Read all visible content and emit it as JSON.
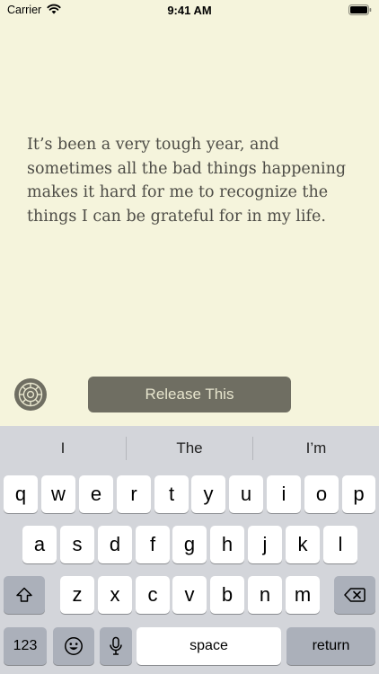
{
  "status_bar": {
    "carrier": "Carrier",
    "time": "9:41 AM"
  },
  "entry": {
    "text": "It’s been a very tough year, and sometimes all the bad things happening makes it hard for me to recognize the things I can be grateful for in my life."
  },
  "controls": {
    "release_label": "Release This"
  },
  "keyboard": {
    "suggestions": [
      "I",
      "The",
      "I’m"
    ],
    "row1": [
      "q",
      "w",
      "e",
      "r",
      "t",
      "y",
      "u",
      "i",
      "o",
      "p"
    ],
    "row2": [
      "a",
      "s",
      "d",
      "f",
      "g",
      "h",
      "j",
      "k",
      "l"
    ],
    "row3": [
      "z",
      "x",
      "c",
      "v",
      "b",
      "n",
      "m"
    ],
    "numbers_label": "123",
    "space_label": "space",
    "return_label": "return"
  },
  "colors": {
    "background": "#f5f4dc",
    "button": "#6f6e62",
    "button_text": "#e7e5cd",
    "keyboard_bg": "#d3d5da"
  }
}
